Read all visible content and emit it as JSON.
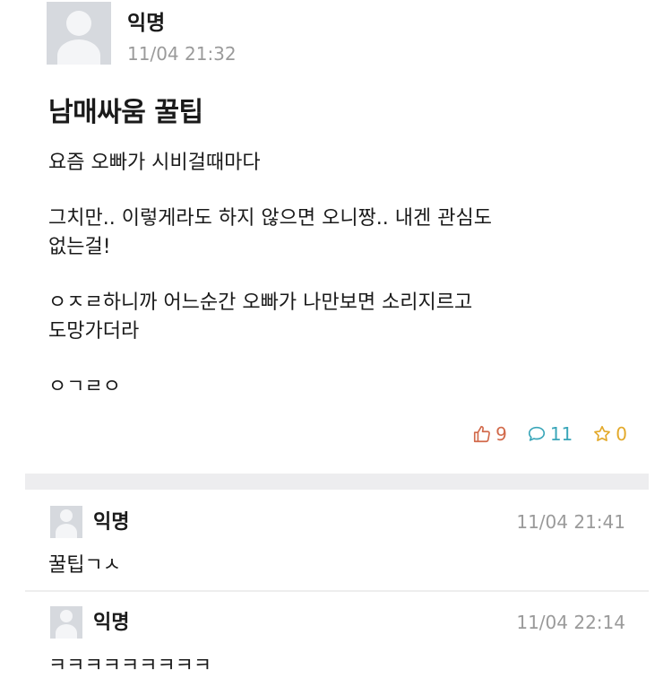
{
  "post": {
    "author": "익명",
    "time": "11/04 21:32",
    "title": "남매싸움 꿀팁",
    "paragraphs": [
      "요즘 오빠가 시비걸때마다",
      "그치만.. 이렇게라도 하지 않으면 오니짱.. 내겐 관심도\n없는걸!",
      "ㅇㅈㄹ하니까 어느순간 오빠가 나만보면 소리지르고\n도망가더라",
      "ㅇㄱㄹㅇ"
    ],
    "stats": {
      "likes": "9",
      "comments": "11",
      "scraps": "0"
    }
  },
  "comments": [
    {
      "author": "익명",
      "time": "11/04 21:41",
      "text": "꿀팁ㄱㅅ"
    },
    {
      "author": "익명",
      "time": "11/04 22:14",
      "text": "ㅋㅋㅋㅋㅋㅋㅋㅋㅋ"
    }
  ],
  "icons": {
    "like": "thumbs-up-icon",
    "comment": "speech-bubble-icon",
    "scrap": "star-icon"
  },
  "colors": {
    "like": "#d26a4b",
    "comment": "#3aa6b9",
    "scrap": "#e3a92a",
    "meta": "#9a9a9a"
  }
}
